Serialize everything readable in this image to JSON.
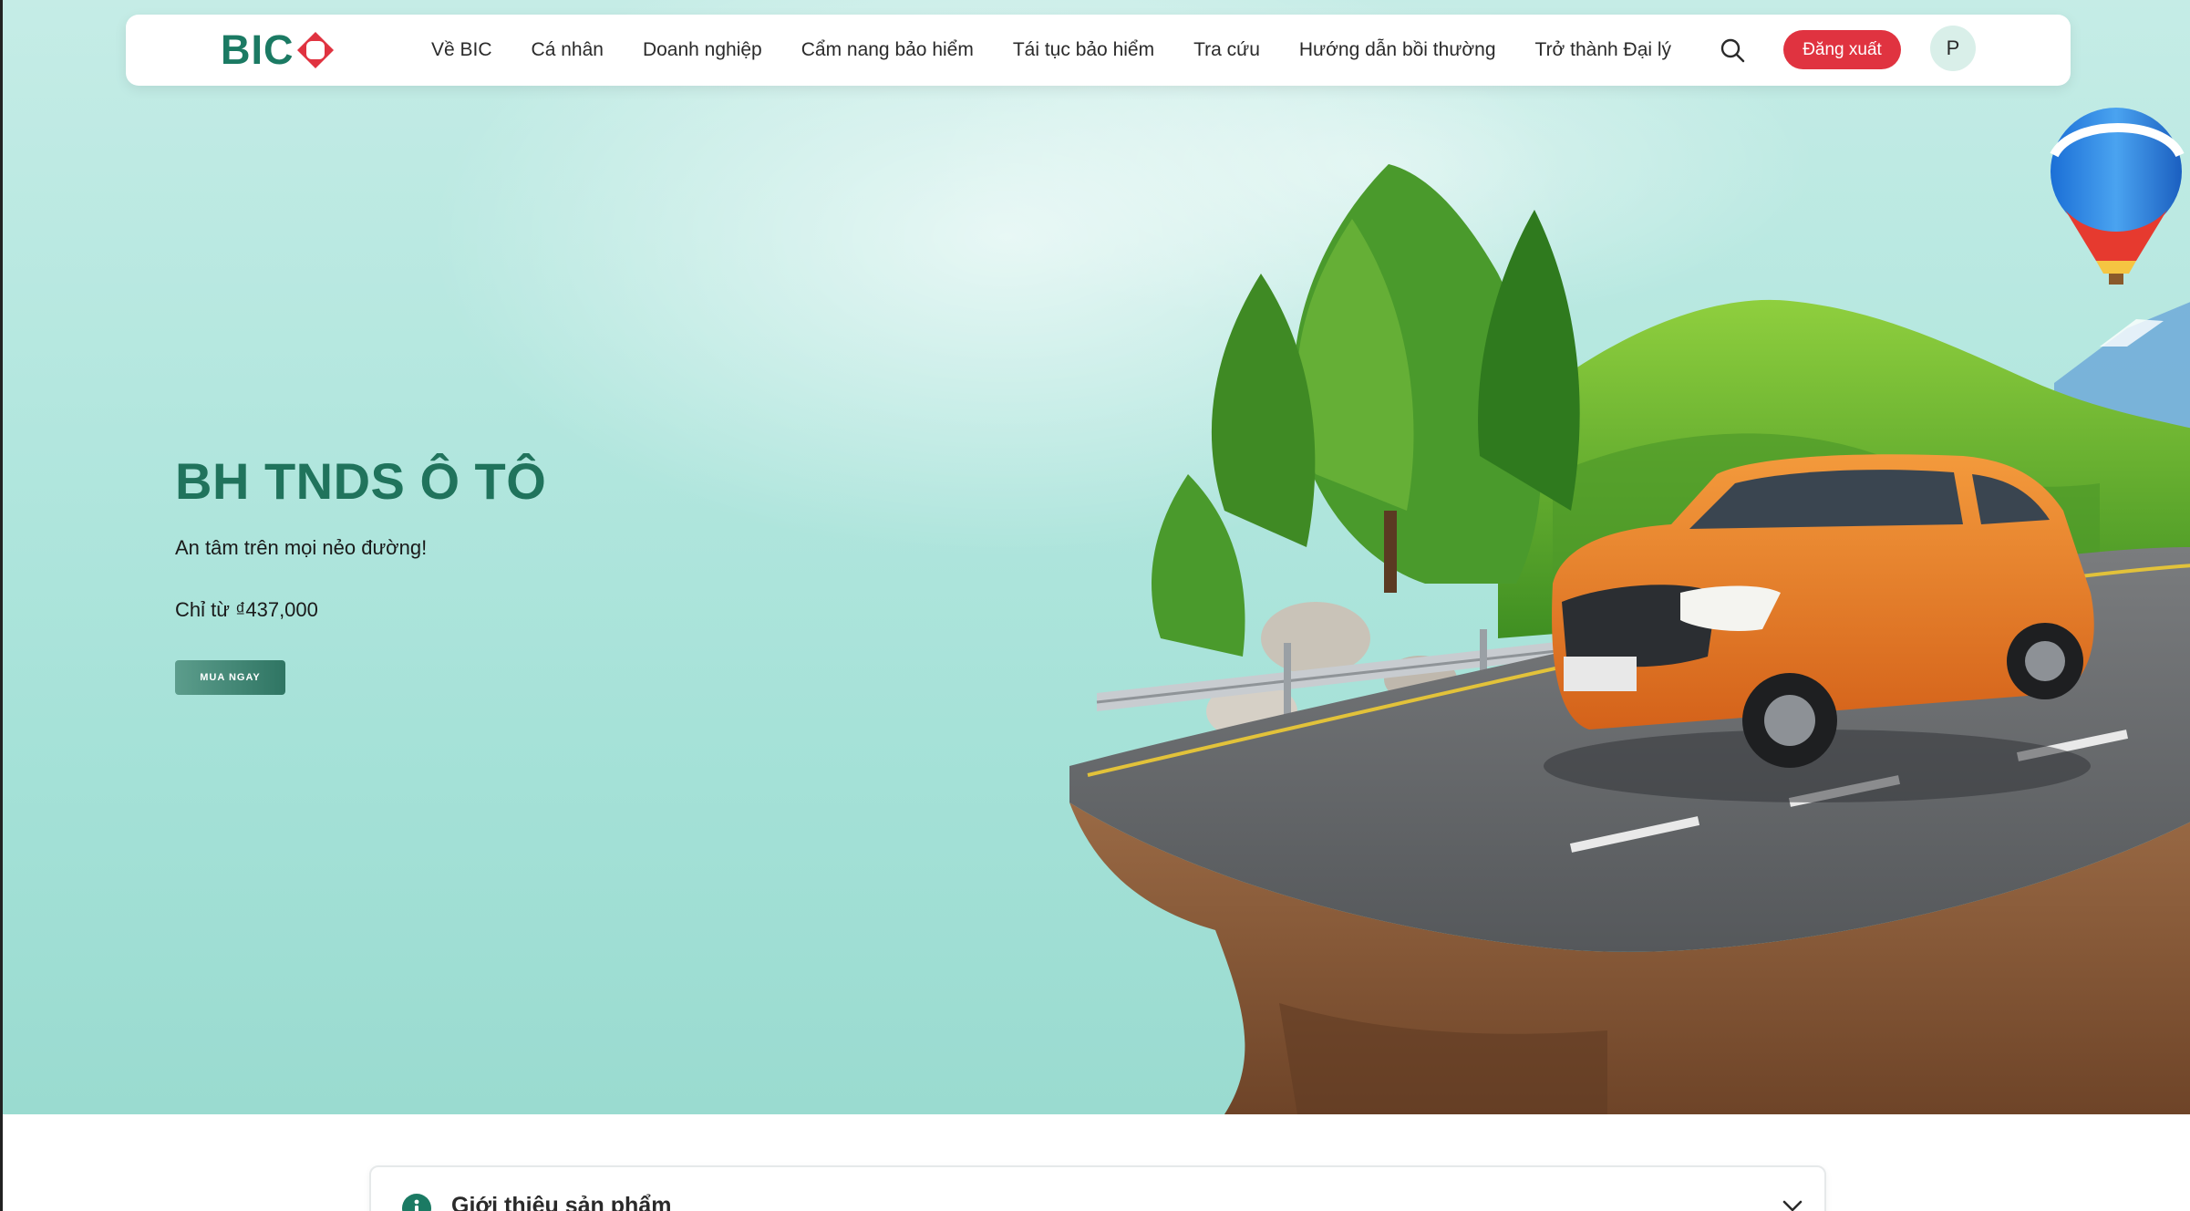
{
  "brand": {
    "logo_text": "BIC",
    "colors": {
      "primary_green": "#1b7a63",
      "logo_red": "#e03340",
      "hero_bg": "#b4e7df"
    }
  },
  "navbar": {
    "items": [
      {
        "label": "Về BIC"
      },
      {
        "label": "Cá nhân"
      },
      {
        "label": "Doanh nghiệp"
      },
      {
        "label": "Cẩm nang bảo hiểm"
      },
      {
        "label": "Tái tục bảo hiểm"
      },
      {
        "label": "Tra cứu"
      },
      {
        "label": "Hướng dẫn bồi thường"
      },
      {
        "label": "Trở thành Đại lý"
      }
    ],
    "search_icon": "search-icon",
    "logout_label": "Đăng xuất",
    "avatar_initial": "P"
  },
  "hero": {
    "title": "BH TNDS Ô TÔ",
    "subtitle": "An tâm trên mọi nẻo đường!",
    "price": "Chỉ từ ₫437,000",
    "cta_label": "MUA NGAY",
    "illustration": "orange car on a floating road island with trees, mountains and a hot air balloon"
  },
  "section": {
    "accordion_title": "Giới thiệu sản phẩm",
    "accordion_icon": "info-icon",
    "chevron_icon": "chevron-down-icon"
  }
}
